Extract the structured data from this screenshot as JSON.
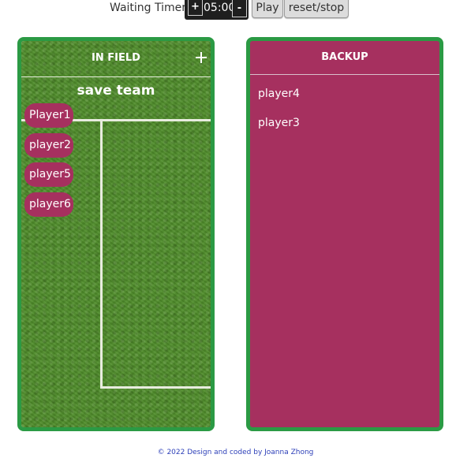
{
  "timer": {
    "label": "Waiting Timer",
    "plus_label": "+",
    "value": "05:00",
    "minus_label": "-"
  },
  "controls": {
    "play_label": "Play",
    "reset_label": "reset/stop"
  },
  "in_field": {
    "title": "IN FIELD",
    "save_label": "save team",
    "players": [
      "Player1",
      "player2",
      "player5",
      "player6"
    ]
  },
  "backup": {
    "title": "BACKUP",
    "players": [
      "player4",
      "player3"
    ]
  },
  "footer": {
    "text": "© 2022 Design and coded by Joanna Zhong"
  },
  "colors": {
    "panel_border": "#2b9a44",
    "accent": "#a6305f",
    "field_green": "#4f8d2a"
  }
}
